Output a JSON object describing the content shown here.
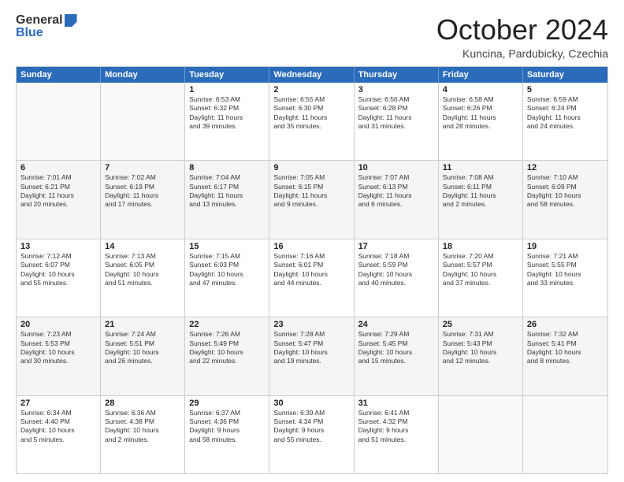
{
  "logo": {
    "line1": "General",
    "line2": "Blue"
  },
  "title": "October 2024",
  "subtitle": "Kuncina, Pardubicky, Czechia",
  "header_days": [
    "Sunday",
    "Monday",
    "Tuesday",
    "Wednesday",
    "Thursday",
    "Friday",
    "Saturday"
  ],
  "weeks": [
    [
      {
        "day": "",
        "info": ""
      },
      {
        "day": "",
        "info": ""
      },
      {
        "day": "1",
        "info": "Sunrise: 6:53 AM\nSunset: 6:32 PM\nDaylight: 11 hours\nand 39 minutes."
      },
      {
        "day": "2",
        "info": "Sunrise: 6:55 AM\nSunset: 6:30 PM\nDaylight: 11 hours\nand 35 minutes."
      },
      {
        "day": "3",
        "info": "Sunrise: 6:56 AM\nSunset: 6:28 PM\nDaylight: 11 hours\nand 31 minutes."
      },
      {
        "day": "4",
        "info": "Sunrise: 6:58 AM\nSunset: 6:26 PM\nDaylight: 11 hours\nand 28 minutes."
      },
      {
        "day": "5",
        "info": "Sunrise: 6:59 AM\nSunset: 6:24 PM\nDaylight: 11 hours\nand 24 minutes."
      }
    ],
    [
      {
        "day": "6",
        "info": "Sunrise: 7:01 AM\nSunset: 6:21 PM\nDaylight: 11 hours\nand 20 minutes."
      },
      {
        "day": "7",
        "info": "Sunrise: 7:02 AM\nSunset: 6:19 PM\nDaylight: 11 hours\nand 17 minutes."
      },
      {
        "day": "8",
        "info": "Sunrise: 7:04 AM\nSunset: 6:17 PM\nDaylight: 11 hours\nand 13 minutes."
      },
      {
        "day": "9",
        "info": "Sunrise: 7:05 AM\nSunset: 6:15 PM\nDaylight: 11 hours\nand 9 minutes."
      },
      {
        "day": "10",
        "info": "Sunrise: 7:07 AM\nSunset: 6:13 PM\nDaylight: 11 hours\nand 6 minutes."
      },
      {
        "day": "11",
        "info": "Sunrise: 7:08 AM\nSunset: 6:11 PM\nDaylight: 11 hours\nand 2 minutes."
      },
      {
        "day": "12",
        "info": "Sunrise: 7:10 AM\nSunset: 6:09 PM\nDaylight: 10 hours\nand 58 minutes."
      }
    ],
    [
      {
        "day": "13",
        "info": "Sunrise: 7:12 AM\nSunset: 6:07 PM\nDaylight: 10 hours\nand 55 minutes."
      },
      {
        "day": "14",
        "info": "Sunrise: 7:13 AM\nSunset: 6:05 PM\nDaylight: 10 hours\nand 51 minutes."
      },
      {
        "day": "15",
        "info": "Sunrise: 7:15 AM\nSunset: 6:03 PM\nDaylight: 10 hours\nand 47 minutes."
      },
      {
        "day": "16",
        "info": "Sunrise: 7:16 AM\nSunset: 6:01 PM\nDaylight: 10 hours\nand 44 minutes."
      },
      {
        "day": "17",
        "info": "Sunrise: 7:18 AM\nSunset: 5:59 PM\nDaylight: 10 hours\nand 40 minutes."
      },
      {
        "day": "18",
        "info": "Sunrise: 7:20 AM\nSunset: 5:57 PM\nDaylight: 10 hours\nand 37 minutes."
      },
      {
        "day": "19",
        "info": "Sunrise: 7:21 AM\nSunset: 5:55 PM\nDaylight: 10 hours\nand 33 minutes."
      }
    ],
    [
      {
        "day": "20",
        "info": "Sunrise: 7:23 AM\nSunset: 5:53 PM\nDaylight: 10 hours\nand 30 minutes."
      },
      {
        "day": "21",
        "info": "Sunrise: 7:24 AM\nSunset: 5:51 PM\nDaylight: 10 hours\nand 26 minutes."
      },
      {
        "day": "22",
        "info": "Sunrise: 7:26 AM\nSunset: 5:49 PM\nDaylight: 10 hours\nand 22 minutes."
      },
      {
        "day": "23",
        "info": "Sunrise: 7:28 AM\nSunset: 5:47 PM\nDaylight: 10 hours\nand 19 minutes."
      },
      {
        "day": "24",
        "info": "Sunrise: 7:29 AM\nSunset: 5:45 PM\nDaylight: 10 hours\nand 15 minutes."
      },
      {
        "day": "25",
        "info": "Sunrise: 7:31 AM\nSunset: 5:43 PM\nDaylight: 10 hours\nand 12 minutes."
      },
      {
        "day": "26",
        "info": "Sunrise: 7:32 AM\nSunset: 5:41 PM\nDaylight: 10 hours\nand 8 minutes."
      }
    ],
    [
      {
        "day": "27",
        "info": "Sunrise: 6:34 AM\nSunset: 4:40 PM\nDaylight: 10 hours\nand 5 minutes."
      },
      {
        "day": "28",
        "info": "Sunrise: 6:36 AM\nSunset: 4:38 PM\nDaylight: 10 hours\nand 2 minutes."
      },
      {
        "day": "29",
        "info": "Sunrise: 6:37 AM\nSunset: 4:36 PM\nDaylight: 9 hours\nand 58 minutes."
      },
      {
        "day": "30",
        "info": "Sunrise: 6:39 AM\nSunset: 4:34 PM\nDaylight: 9 hours\nand 55 minutes."
      },
      {
        "day": "31",
        "info": "Sunrise: 6:41 AM\nSunset: 4:32 PM\nDaylight: 9 hours\nand 51 minutes."
      },
      {
        "day": "",
        "info": ""
      },
      {
        "day": "",
        "info": ""
      }
    ]
  ]
}
